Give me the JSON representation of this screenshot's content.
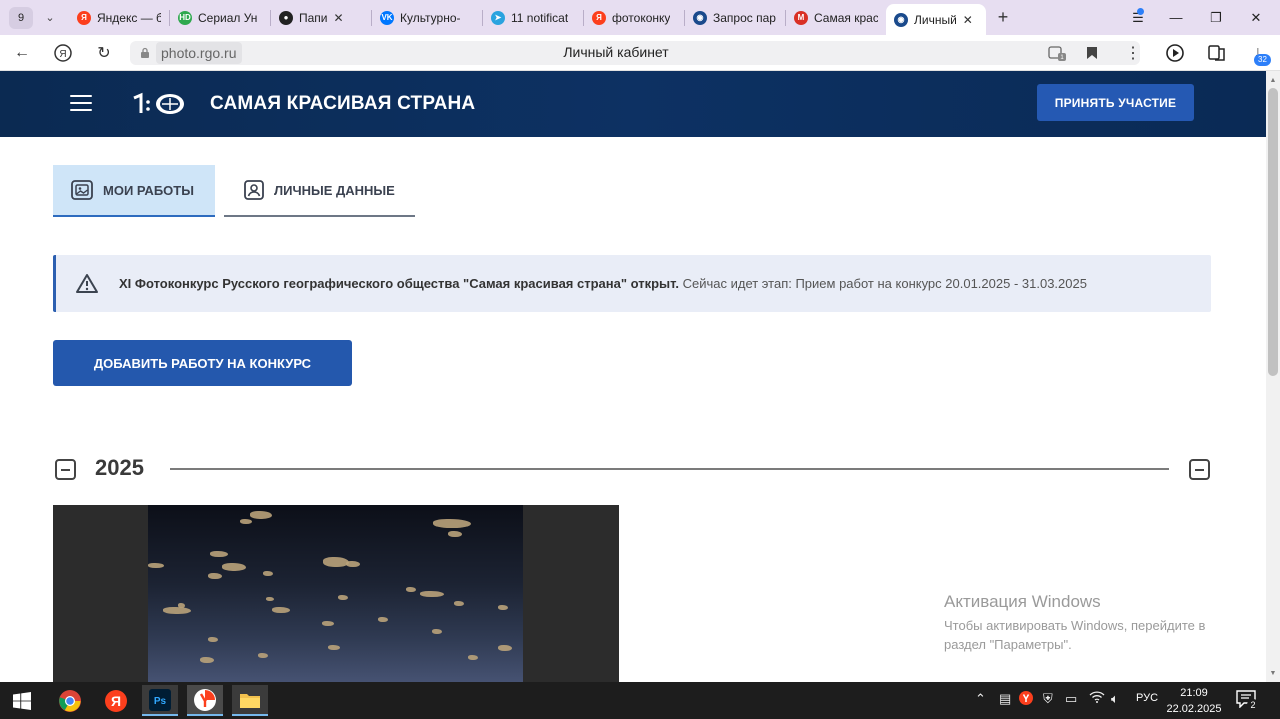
{
  "browser": {
    "tab_count": "9",
    "tabs": [
      {
        "title": "Яндекс — б",
        "icon": "yandex-icon",
        "color": "#fc3f1d",
        "letter": "Я"
      },
      {
        "title": "Сериал Ун",
        "icon": "hd-icon",
        "color": "#2fa84f",
        "letter": "HD"
      },
      {
        "title": "Папи",
        "icon": "video-icon",
        "color": "#222222",
        "letter": "●"
      },
      {
        "title": "Культурно-",
        "icon": "vk-icon",
        "color": "#0077ff",
        "letter": "VK"
      },
      {
        "title": "11 notificat",
        "icon": "telegram-icon",
        "color": "#2aa3df",
        "letter": "➤"
      },
      {
        "title": "фотоконку",
        "icon": "yandex-icon",
        "color": "#fc3f1d",
        "letter": "Я"
      },
      {
        "title": "Запрос пар",
        "icon": "rgo-icon",
        "color": "#1a4a8c",
        "letter": "◉"
      },
      {
        "title": "Самая крас",
        "icon": "gmail-icon",
        "color": "#d93025",
        "letter": "M"
      },
      {
        "title": "Личный",
        "icon": "rgo-icon",
        "color": "#1a4a8c",
        "letter": "◉"
      }
    ],
    "url_domain": "photo.rgo.ru",
    "page_title": "Личный кабинет",
    "downloads_badge": "32"
  },
  "site": {
    "title": "САМАЯ КРАСИВАЯ СТРАНА",
    "join_button": "ПРИНЯТЬ УЧАСТИЕ"
  },
  "cabinet": {
    "tabs": [
      {
        "label": "МОИ РАБОТЫ",
        "active": true
      },
      {
        "label": "ЛИЧНЫЕ ДАННЫЕ",
        "active": false
      }
    ],
    "notice": {
      "bold": "XI Фотоконкурс Русского географического общества \"Самая красивая страна\" открыт.",
      "text": " Сейчас идет этап: Прием работ на конкурс 20.01.2025 - 31.03.2025"
    },
    "add_work_button": "ДОБАВИТЬ РАБОТУ НА КОНКУРС",
    "year": "2025"
  },
  "watermark": {
    "title": "Активация Windows",
    "subtitle": "Чтобы активировать Windows, перейдите в раздел \"Параметры\"."
  },
  "taskbar": {
    "language": "РУС",
    "time": "21:09",
    "date": "22.02.2025",
    "notifications": "2"
  }
}
